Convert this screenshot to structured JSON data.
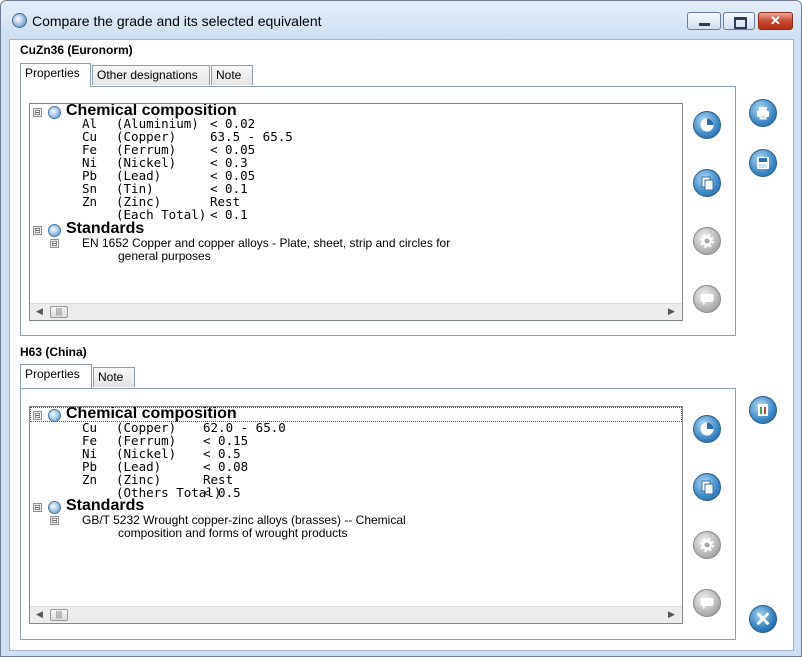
{
  "window": {
    "title": "Compare the grade and its selected equivalent",
    "close_glyph": "✕"
  },
  "grade1": {
    "title": "CuZn36 (Euronorm)",
    "tabs": [
      "Properties",
      "Other designations",
      "Note"
    ],
    "chem_heading": "Chemical composition",
    "elements": [
      [
        "Al",
        "(Aluminium)",
        "< 0.02"
      ],
      [
        "Cu",
        "(Copper)",
        "63.5 - 65.5"
      ],
      [
        "Fe",
        "(Ferrum)",
        "< 0.05"
      ],
      [
        "Ni",
        "(Nickel)",
        "< 0.3"
      ],
      [
        "Pb",
        "(Lead)",
        "< 0.05"
      ],
      [
        "Sn",
        "(Tin)",
        "< 0.1"
      ],
      [
        "Zn",
        "(Zinc)",
        "Rest"
      ],
      [
        "",
        "(Each Total)",
        "< 0.1"
      ]
    ],
    "std_heading": "Standards",
    "std_line1": "EN 1652 Copper and copper alloys - Plate, sheet, strip and circles for",
    "std_line2": "general purposes"
  },
  "grade2": {
    "title": "H63 (China)",
    "tabs": [
      "Properties",
      "Note"
    ],
    "chem_heading": "Chemical composition",
    "elements": [
      [
        "Cu",
        "(Copper)",
        "62.0 - 65.0"
      ],
      [
        "Fe",
        "(Ferrum)",
        "< 0.15"
      ],
      [
        "Ni",
        "(Nickel)",
        "< 0.5"
      ],
      [
        "Pb",
        "(Lead)",
        "< 0.08"
      ],
      [
        "Zn",
        "(Zinc)",
        "Rest"
      ],
      [
        "",
        "(Others Total)",
        "< 0.5"
      ]
    ],
    "std_heading": "Standards",
    "std_line1": "GB/T 5232 Wrought copper-zinc alloys (brasses) -- Chemical",
    "std_line2": "composition and forms of wrought products"
  },
  "icons": {
    "expand_minus": "⊟",
    "scroll_thumb": "|||",
    "scroll_left": "◀",
    "scroll_right": "▶"
  }
}
